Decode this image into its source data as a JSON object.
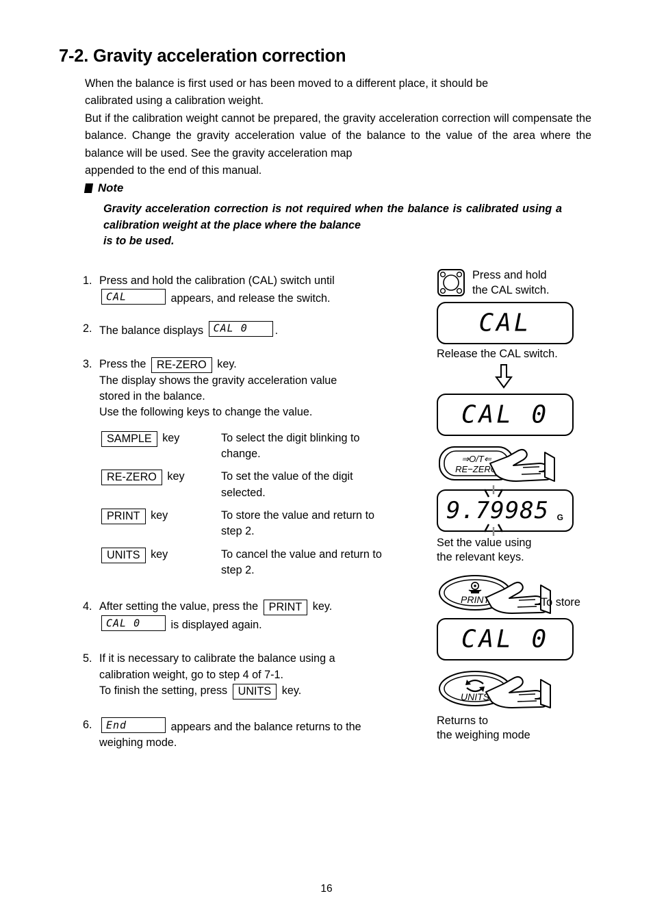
{
  "heading": "7-2. Gravity acceleration correction",
  "intro": {
    "para1_line1": "When the balance is first used or has been moved to a different place, it should be",
    "para1_line2": "calibrated using a calibration weight.",
    "para2": "But if the calibration weight cannot be prepared, the gravity acceleration correction will compensate the balance. Change the gravity acceleration value of the balance to the value of the area where the balance will be used. See the gravity acceleration map",
    "para2_last": "appended to the end of this manual."
  },
  "note": {
    "title": "Note",
    "body": "Gravity acceleration correction is not required when the balance is calibrated using a calibration weight at the place where the balance",
    "body_last": "is to be used."
  },
  "steps": {
    "s1": {
      "num": "1.",
      "line1": "Press and hold the calibration (CAL) switch until",
      "display": "CAL",
      "line2_after": "appears, and release the switch."
    },
    "s2": {
      "num": "2.",
      "line1": "The balance displays",
      "display": "CAL 0",
      "after": "."
    },
    "s3": {
      "num": "3.",
      "lead": "Press the",
      "key": "RE-ZERO",
      "lead_after": "key.",
      "line2": "The display shows the gravity acceleration value",
      "line3": "stored in the balance.",
      "line4": "Use the following keys to change the value.",
      "keys": [
        {
          "key": "SAMPLE",
          "key_suffix": "key",
          "desc": "To select the digit blinking to",
          "desc_last": "change."
        },
        {
          "key": "RE-ZERO",
          "key_suffix": "key",
          "desc": "To set the value of the digit",
          "desc_last": "selected."
        },
        {
          "key": "PRINT",
          "key_suffix": "key",
          "desc": "To store the value and return to",
          "desc_last": "step 2."
        },
        {
          "key": "UNITS",
          "key_suffix": "key",
          "desc": "To cancel the value and return to",
          "desc_last": "step 2."
        }
      ]
    },
    "s4": {
      "num": "4.",
      "line1a": "After setting the value, press the",
      "key": "PRINT",
      "line1b": "key.",
      "display": "CAL 0",
      "line2b": "is displayed again."
    },
    "s5": {
      "num": "5.",
      "line1": "If it is necessary to calibrate the balance using a",
      "line2": "calibration weight, go to step 4 of 7-1.",
      "line3a": "To finish the setting, press",
      "key": "UNITS",
      "line3b": "key."
    },
    "s6": {
      "num": "6.",
      "display": "End",
      "line1": "appears and the balance returns to the",
      "line2": "weighing mode."
    }
  },
  "right": {
    "cal_switch_caption_l1": "Press and hold",
    "cal_switch_caption_l2": "the CAL switch.",
    "lcd1": "CAL",
    "release_caption": "Release the CAL switch.",
    "lcd2": "CAL 0",
    "rezero_top": "O/T",
    "rezero_label": "RE−ZERO",
    "lcd_value": "9.79985",
    "lcd_value_unit": "G",
    "set_value_l1": "Set the value using",
    "set_value_l2": "the relevant keys.",
    "print_label": "PRINT",
    "to_store": "To store",
    "lcd3": "CAL 0",
    "units_label": "UNITS",
    "returns_l1": "Returns to",
    "returns_l2": "the weighing mode"
  },
  "page_number": "16"
}
